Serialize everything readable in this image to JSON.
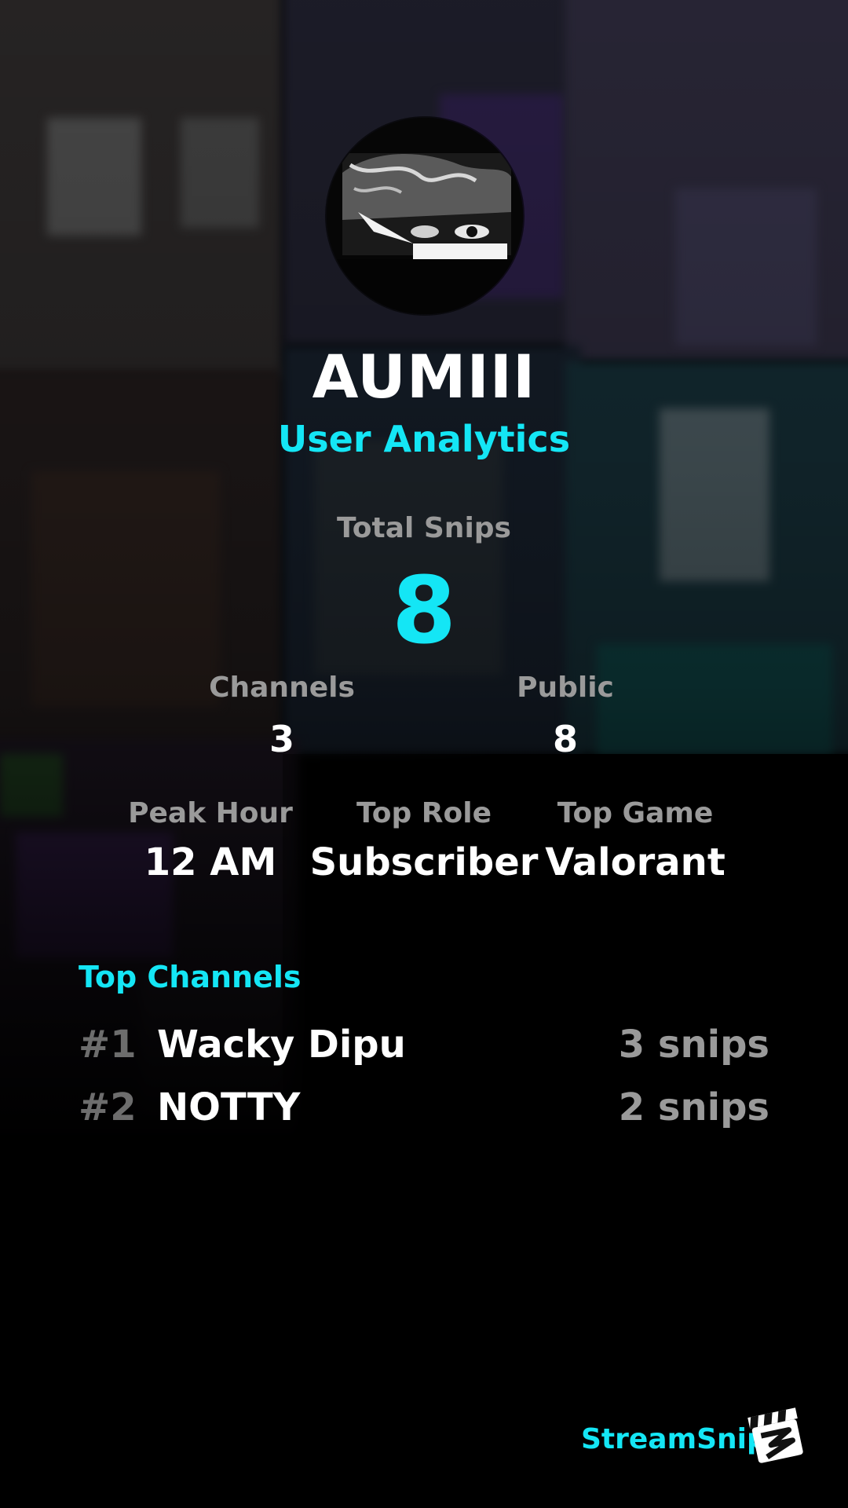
{
  "profile": {
    "username": "AUMIII",
    "subtitle": "User Analytics"
  },
  "stats": {
    "total_label": "Total Snips",
    "total_value": "8",
    "channels_label": "Channels",
    "channels_value": "3",
    "public_label": "Public",
    "public_value": "8",
    "peak_hour_label": "Peak Hour",
    "peak_hour_value": "12 AM",
    "top_role_label": "Top Role",
    "top_role_value": "Subscriber",
    "top_game_label": "Top Game",
    "top_game_value": "Valorant"
  },
  "top_channels": {
    "title": "Top Channels",
    "items": [
      {
        "rank": "#1",
        "name": "Wacky Dipu",
        "snips": "3 snips"
      },
      {
        "rank": "#2",
        "name": "NOTTY",
        "snips": "2 snips"
      }
    ]
  },
  "branding": {
    "name": "StreamSnip",
    "logo_icon": "clapperboard-icon"
  },
  "colors": {
    "accent": "#14e6f5",
    "label": "#9a9a9a",
    "rank": "#6d6d6d",
    "text": "#ffffff",
    "background": "#000000"
  }
}
